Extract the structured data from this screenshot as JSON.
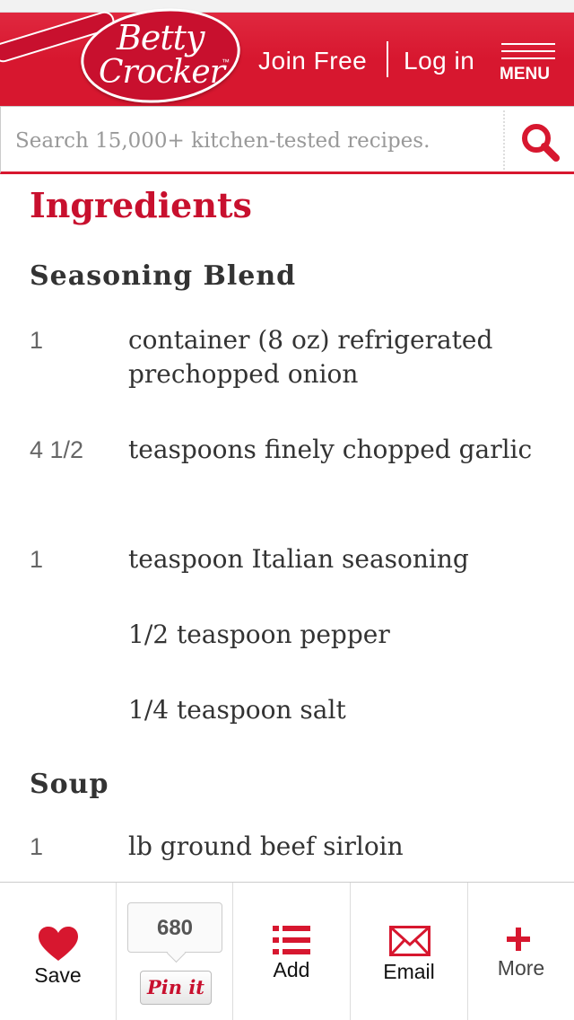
{
  "header": {
    "logo_line1": "Betty",
    "logo_line2": "Crocker",
    "logo_tm": "™",
    "join_label": "Join Free",
    "login_label": "Log in",
    "menu_label": "MENU",
    "brand_color": "#d7172f"
  },
  "search": {
    "placeholder": "Search 15,000+ kitchen-tested recipes."
  },
  "ingredients": {
    "title": "Ingredients",
    "groups": [
      {
        "title": "Seasoning Blend",
        "items": [
          {
            "qty": "1",
            "desc": "container (8 oz) refrigerated prechopped onion"
          },
          {
            "qty": "4 1/2",
            "desc": "teaspoons finely chopped garlic"
          },
          {
            "qty": "1",
            "desc": "teaspoon Italian seasoning"
          },
          {
            "qty": "",
            "desc": "1/2 teaspoon pepper"
          },
          {
            "qty": "",
            "desc": "1/4 teaspoon salt"
          }
        ]
      },
      {
        "title": "Soup",
        "items": [
          {
            "qty": "1",
            "desc": "lb ground beef sirloin"
          }
        ]
      }
    ]
  },
  "bottombar": {
    "save_label": "Save",
    "pin_count": "680",
    "pin_label": "Pin it",
    "add_label": "Add",
    "email_label": "Email",
    "more_label": "More",
    "icons": [
      "heart-icon",
      "pinterest-icon",
      "list-icon",
      "envelope-icon",
      "plus-icon"
    ]
  }
}
